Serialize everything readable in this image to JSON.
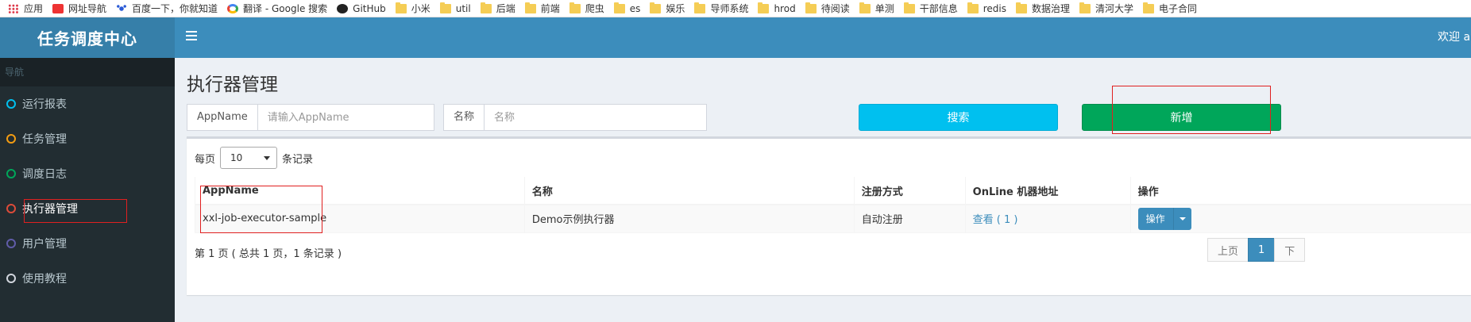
{
  "bookmarks": [
    {
      "label": "应用",
      "icon": "apps-grid-icon"
    },
    {
      "label": "网址导航",
      "icon": "hao-icon"
    },
    {
      "label": "百度一下，你就知道",
      "icon": "baidu-paw-icon"
    },
    {
      "label": "翻译 - Google 搜索",
      "icon": "google-icon"
    },
    {
      "label": "GitHub",
      "icon": "github-icon"
    },
    {
      "label": "小米",
      "icon": "folder-icon"
    },
    {
      "label": "util",
      "icon": "folder-icon"
    },
    {
      "label": "后端",
      "icon": "folder-icon"
    },
    {
      "label": "前端",
      "icon": "folder-icon"
    },
    {
      "label": "爬虫",
      "icon": "folder-icon"
    },
    {
      "label": "es",
      "icon": "folder-icon"
    },
    {
      "label": "娱乐",
      "icon": "folder-icon"
    },
    {
      "label": "导师系统",
      "icon": "folder-icon"
    },
    {
      "label": "hrod",
      "icon": "folder-icon"
    },
    {
      "label": "待阅读",
      "icon": "folder-icon"
    },
    {
      "label": "单测",
      "icon": "folder-icon"
    },
    {
      "label": "干部信息",
      "icon": "folder-icon"
    },
    {
      "label": "redis",
      "icon": "folder-icon"
    },
    {
      "label": "数据治理",
      "icon": "folder-icon"
    },
    {
      "label": "清河大学",
      "icon": "folder-icon"
    },
    {
      "label": "电子合同",
      "icon": "folder-icon"
    }
  ],
  "header": {
    "logo": "任务调度中心",
    "welcome": "欢迎 a"
  },
  "sidebar": {
    "header": "导航",
    "items": [
      {
        "label": "运行报表",
        "color": "#00c0ef"
      },
      {
        "label": "任务管理",
        "color": "#f39c12"
      },
      {
        "label": "调度日志",
        "color": "#00a65a"
      },
      {
        "label": "执行器管理",
        "color": "#dd4b39"
      },
      {
        "label": "用户管理",
        "color": "#605ca8"
      },
      {
        "label": "使用教程",
        "color": "#d2d6de"
      }
    ],
    "active_index": 3
  },
  "main": {
    "title": "执行器管理",
    "filters": {
      "appname_label": "AppName",
      "appname_placeholder": "请输入AppName",
      "title_label": "名称",
      "title_placeholder": "名称"
    },
    "search_label": "搜索",
    "add_label": "新增",
    "page_size": {
      "prefix": "每页",
      "value": "10",
      "suffix": "条记录"
    },
    "table": {
      "columns": [
        "AppName",
        "名称",
        "注册方式",
        "OnLine 机器地址",
        "操作"
      ],
      "rows": [
        {
          "appname": "xxl-job-executor-sample",
          "title": "Demo示例执行器",
          "register": "自动注册",
          "online": "查看 ( 1 )",
          "action": "操作"
        }
      ]
    },
    "page_info": "第 1 页 ( 总共 1 页，1 条记录 )",
    "pagination": {
      "prev": "上页",
      "current": "1",
      "next": "下"
    }
  }
}
